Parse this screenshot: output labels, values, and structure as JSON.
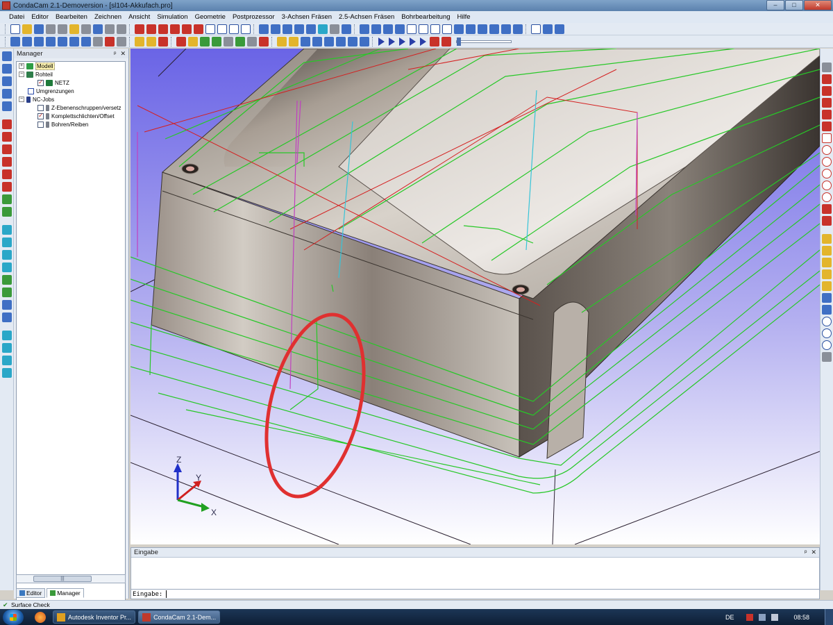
{
  "window": {
    "title": "CondaCam 2.1-Demoversion - [sl104-Akkufach.pro]",
    "controls": [
      "–",
      "□",
      "✕"
    ]
  },
  "menu": [
    "Datei",
    "Editor",
    "Bearbeiten",
    "Zeichnen",
    "Ansicht",
    "Simulation",
    "Geometrie",
    "Postprozessor",
    "3-Achsen Fräsen",
    "2.5-Achsen Fräsen",
    "Bohrbearbeitung",
    "Hilfe"
  ],
  "manager": {
    "title": "Manager",
    "pin": "ᵖ",
    "close": "✕",
    "tree": {
      "modell": "Modell",
      "rohteil": "Rohteil",
      "netz": "NETZ",
      "umgrenzungen": "Umgrenzungen",
      "ncjobs": "NC-Jobs",
      "jobs": [
        "Z-Ebenenschruppen/versetz",
        "Komplettschlichten/Offset",
        "Bohren/Reiben"
      ]
    },
    "scroll_thumb": "|||",
    "tabs": [
      "Editor",
      "Manager"
    ]
  },
  "input": {
    "title": "Eingabe",
    "pin": "ᵖ",
    "close": "✕",
    "prompt": "Eingabe:",
    "value": ""
  },
  "axes": {
    "z": "Z",
    "y": "Y",
    "x": "X"
  },
  "status": {
    "text": "Surface Check"
  },
  "taskbar": {
    "tasks": [
      "Autodesk Inventor Pr...",
      "CondaCam 2.1-Dem..."
    ],
    "language": "DE",
    "time": "08:58"
  },
  "colors": {
    "viewport_top": "#6a64e6",
    "viewport_bottom": "#ffffff",
    "toolpath": "#27c827",
    "rapid": "#d42020",
    "plunge": "#c040c0",
    "accent_cyan": "#36c4d8",
    "highlight_circle": "#e03030"
  },
  "icons": {
    "start": "windows-start-icon",
    "firefox": "firefox-icon",
    "status": "check-icon"
  }
}
